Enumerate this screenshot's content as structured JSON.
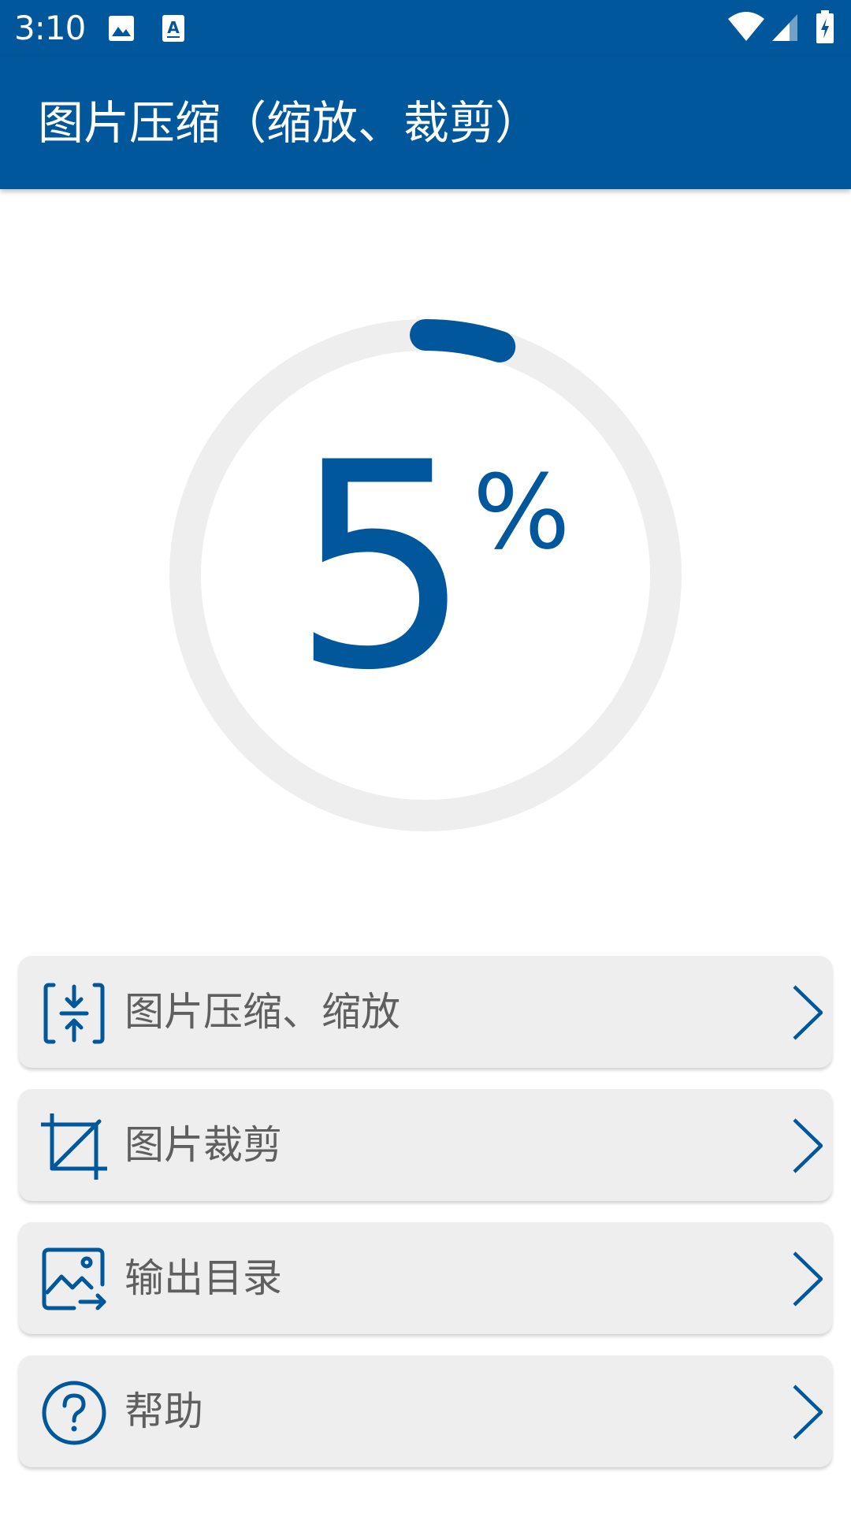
{
  "status_bar": {
    "time": "3:10",
    "icons": [
      "image-icon",
      "font-a-icon",
      "wifi-icon",
      "cellular-signal-icon",
      "battery-charging-icon"
    ]
  },
  "app_bar": {
    "title": "图片压缩（缩放、裁剪）"
  },
  "progress": {
    "value": "5",
    "unit": "%",
    "fraction": 0.05,
    "track_color": "#eeeeee",
    "fill_color": "#01579b"
  },
  "menu": {
    "items": [
      {
        "label": "图片压缩、缩放",
        "icon": "compress-icon"
      },
      {
        "label": "图片裁剪",
        "icon": "crop-icon"
      },
      {
        "label": "输出目录",
        "icon": "output-folder-icon"
      },
      {
        "label": "帮助",
        "icon": "help-icon"
      }
    ]
  },
  "colors": {
    "primary": "#01579b",
    "card_background": "#eeeeee",
    "label_text": "#5f5f5f"
  }
}
